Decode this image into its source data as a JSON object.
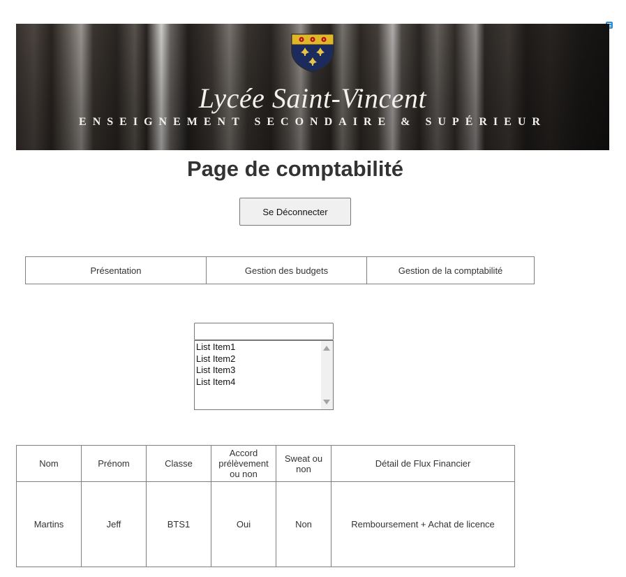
{
  "banner": {
    "title": "Lycée Saint-Vincent",
    "subtitle": "ENSEIGNEMENT SECONDAIRE & SUPÉRIEUR",
    "crest_colors": {
      "top": "#e2b629",
      "bottom": "#1c2b5e",
      "accent": "#b3141c"
    }
  },
  "page_title": "Page de comptabilité",
  "logout_label": "Se Déconnecter",
  "tabs": [
    {
      "label": "Présentation"
    },
    {
      "label": "Gestion des budgets"
    },
    {
      "label": "Gestion de la comptabilité"
    }
  ],
  "text_input": {
    "value": ""
  },
  "listbox": {
    "items": [
      "List Item1",
      "List Item2",
      "List Item3",
      "List Item4"
    ]
  },
  "table": {
    "headers": [
      "Nom",
      "Prénom",
      "Classe",
      "Accord prélèvement ou non",
      "Sweat ou non",
      "Détail de Flux Financier"
    ],
    "rows": [
      [
        "Martins",
        "Jeff",
        "BTS1",
        "Oui",
        "Non",
        "Remboursement + Achat de licence"
      ]
    ]
  }
}
